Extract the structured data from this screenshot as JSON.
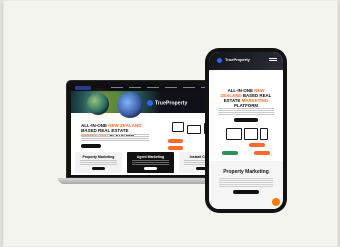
{
  "mockup": {
    "desktop": {
      "brand": "TrueProperty",
      "headline": {
        "part1": "ALL-IN-ONE",
        "accent1": "NEW ZEALAND",
        "part2": "BASED REAL ESTATE",
        "accent2": "MARKETING",
        "part3": "PLATFORM"
      },
      "cards": [
        {
          "title": "Property Marketing"
        },
        {
          "title": "Agent Marketing"
        },
        {
          "title": "Instant Content"
        }
      ]
    },
    "mobile": {
      "brand": "TrueProperty",
      "headline": {
        "part1": "ALL-IN-ONE",
        "accent1": "NEW ZEALAND",
        "part2": "BASED REAL ESTATE",
        "accent2": "MARKETING",
        "part3": "PLATFORM"
      },
      "section_title": "Property Marketing"
    }
  },
  "colors": {
    "background": "#f4f4ee",
    "accent_orange": "#ff6a2a",
    "brand_blue": "#2e64ff",
    "dark": "#111111"
  }
}
